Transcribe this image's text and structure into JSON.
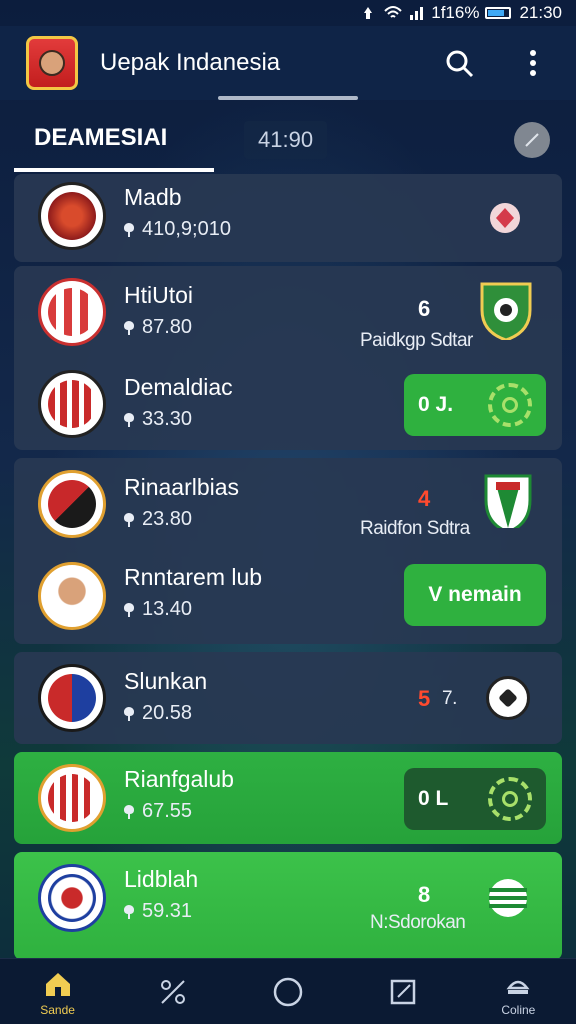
{
  "status": {
    "battery": "1f16%",
    "time": "21:30"
  },
  "app": {
    "title": "Uepak Indanesia"
  },
  "tabs": {
    "active": "DEAMESIAI",
    "time": "41:90"
  },
  "matches": [
    {
      "name": "Madb",
      "stat": "410,9;010",
      "score": "",
      "sub": ""
    },
    {
      "name": "HtiUtoi",
      "stat": "87.80",
      "score": "6",
      "sub": "Paidkgp Sdtar"
    },
    {
      "name": "Demaldiac",
      "stat": "33.30",
      "pill": "0 J."
    },
    {
      "name": "Rinaarlbias",
      "stat": "23.80",
      "score": "4",
      "sub": "Raidfon Sdtra"
    },
    {
      "name": "Rnntarem lub",
      "stat": "13.40",
      "pill": "V nemain"
    },
    {
      "name": "Slunkan",
      "stat": "20.58",
      "score": "5",
      "score2": "7."
    },
    {
      "name": "Rianfgalub",
      "stat": "67.55",
      "pill": "0 L"
    },
    {
      "name": "Lidblah",
      "stat": "59.31",
      "score": "8",
      "sub": "N:Sdorokan"
    }
  ],
  "nav": {
    "home": "Sande",
    "five": "Coline"
  },
  "colors": {
    "accent": "#2fb13f",
    "score_red": "#ff4a2e",
    "nav_active": "#f0cc52"
  }
}
